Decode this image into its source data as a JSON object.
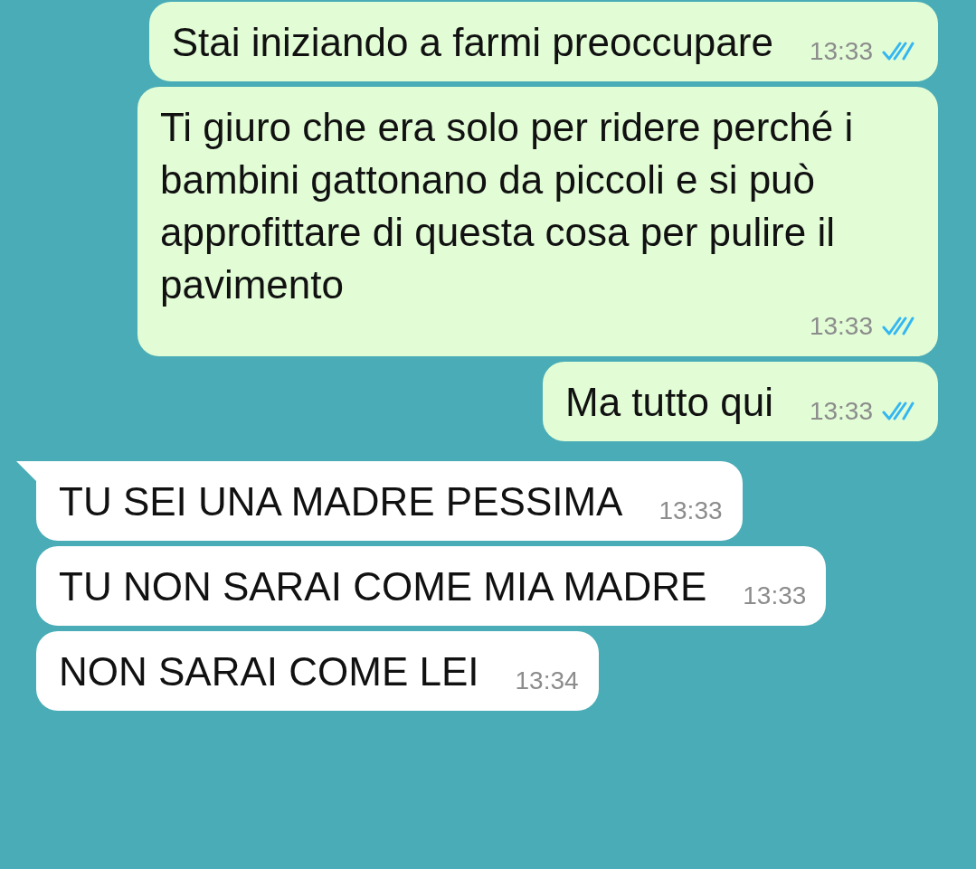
{
  "messages": [
    {
      "kind": "sent",
      "text": "Stai iniziando a farmi preoccupare",
      "time": "13:33",
      "read": true,
      "tail": false
    },
    {
      "kind": "sent",
      "text": "Ti giuro che era solo per ridere perché i bambini gattonano da piccoli e si può approfittare di questa cosa per pulire il pavimento",
      "time": "13:33",
      "read": true,
      "tail": false
    },
    {
      "kind": "sent",
      "text": "Ma tutto qui",
      "time": "13:33",
      "read": true,
      "tail": false
    },
    {
      "kind": "received",
      "text": "TU SEI UNA MADRE PESSIMA",
      "time": "13:33",
      "tail": true
    },
    {
      "kind": "received",
      "text": "TU NON SARAI COME MIA MADRE",
      "time": "13:33",
      "tail": false
    },
    {
      "kind": "received",
      "text": "NON SARAI COME LEI",
      "time": "13:34",
      "tail": false
    }
  ]
}
